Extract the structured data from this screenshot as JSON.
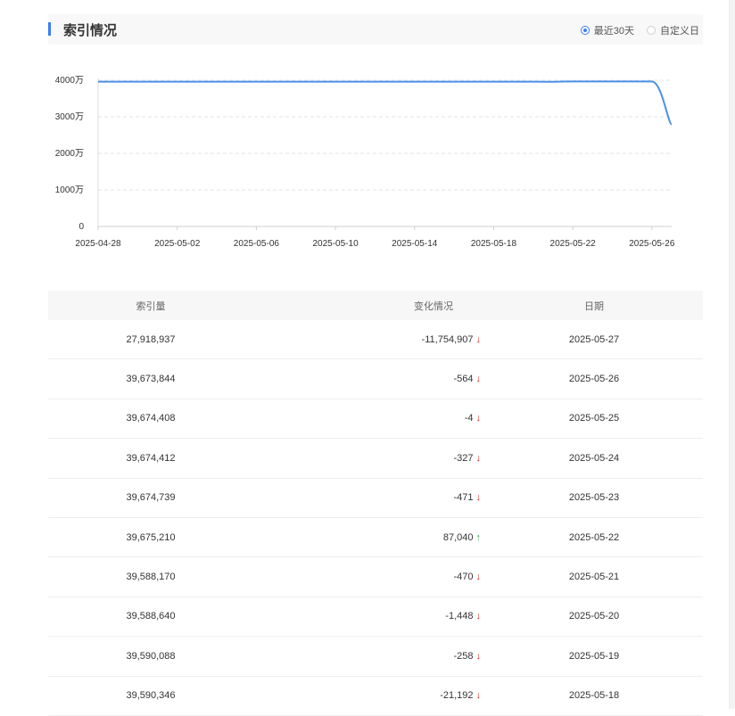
{
  "section": {
    "title": "索引情况",
    "range_options": [
      {
        "label": "最近30天",
        "selected": true
      },
      {
        "label": "自定义日",
        "selected": false
      }
    ]
  },
  "chart_data": {
    "type": "line",
    "x": [
      "2025-04-28",
      "2025-04-29",
      "2025-04-30",
      "2025-05-01",
      "2025-05-02",
      "2025-05-03",
      "2025-05-04",
      "2025-05-05",
      "2025-05-06",
      "2025-05-07",
      "2025-05-08",
      "2025-05-09",
      "2025-05-10",
      "2025-05-11",
      "2025-05-12",
      "2025-05-13",
      "2025-05-14",
      "2025-05-15",
      "2025-05-16",
      "2025-05-17",
      "2025-05-18",
      "2025-05-19",
      "2025-05-20",
      "2025-05-21",
      "2025-05-22",
      "2025-05-23",
      "2025-05-24",
      "2025-05-25",
      "2025-05-26",
      "2025-05-27"
    ],
    "x_tick_labels": [
      "2025-04-28",
      "2025-05-02",
      "2025-05-06",
      "2025-05-10",
      "2025-05-14",
      "2025-05-18",
      "2025-05-22",
      "2025-05-26"
    ],
    "series": [
      {
        "values": [
          39600000,
          39600000,
          39600000,
          39600000,
          39600000,
          39600000,
          39600000,
          39600000,
          39600000,
          39600000,
          39600000,
          39600000,
          39600000,
          39600000,
          39600000,
          39600000,
          39600000,
          39600000,
          39600000,
          39600000,
          39590346,
          39590088,
          39588640,
          39588170,
          39675210,
          39674739,
          39674412,
          39674408,
          39673844,
          27918937
        ]
      }
    ],
    "y_ticks": [
      {
        "value": 0,
        "label": "0"
      },
      {
        "value": 10000000,
        "label": "1000万"
      },
      {
        "value": 20000000,
        "label": "2000万"
      },
      {
        "value": 30000000,
        "label": "3000万"
      },
      {
        "value": 40000000,
        "label": "4000万"
      }
    ],
    "ylim": [
      0,
      40000000
    ],
    "grid": "horizontal dashed",
    "line_color": "#4a90e8"
  },
  "table": {
    "headers": [
      "索引量",
      "变化情况",
      "日期"
    ],
    "rows": [
      {
        "count": "27,918,937",
        "change": "-11,754,907",
        "dir": "down",
        "date": "2025-05-27"
      },
      {
        "count": "39,673,844",
        "change": "-564",
        "dir": "down",
        "date": "2025-05-26"
      },
      {
        "count": "39,674,408",
        "change": "-4",
        "dir": "down",
        "date": "2025-05-25"
      },
      {
        "count": "39,674,412",
        "change": "-327",
        "dir": "down",
        "date": "2025-05-24"
      },
      {
        "count": "39,674,739",
        "change": "-471",
        "dir": "down",
        "date": "2025-05-23"
      },
      {
        "count": "39,675,210",
        "change": "87,040",
        "dir": "up",
        "date": "2025-05-22"
      },
      {
        "count": "39,588,170",
        "change": "-470",
        "dir": "down",
        "date": "2025-05-21"
      },
      {
        "count": "39,588,640",
        "change": "-1,448",
        "dir": "down",
        "date": "2025-05-20"
      },
      {
        "count": "39,590,088",
        "change": "-258",
        "dir": "down",
        "date": "2025-05-19"
      },
      {
        "count": "39,590,346",
        "change": "-21,192",
        "dir": "down",
        "date": "2025-05-18"
      }
    ]
  },
  "icons": {
    "down": "arrow-down-icon",
    "up": "arrow-up-icon",
    "down_color": "#e02020",
    "up_color": "#3aa84a"
  }
}
